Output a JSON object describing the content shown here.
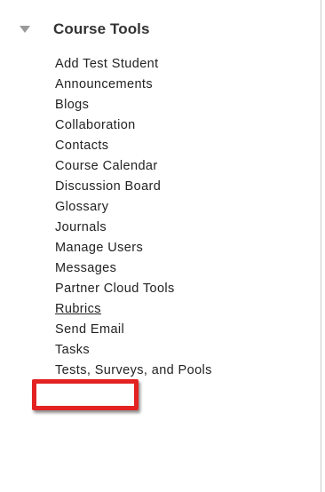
{
  "section": {
    "title": "Course Tools",
    "expanded": true
  },
  "items": [
    {
      "label": "Add Test Student"
    },
    {
      "label": "Announcements"
    },
    {
      "label": "Blogs"
    },
    {
      "label": "Collaboration"
    },
    {
      "label": "Contacts"
    },
    {
      "label": "Course Calendar"
    },
    {
      "label": "Discussion Board"
    },
    {
      "label": "Glossary"
    },
    {
      "label": "Journals"
    },
    {
      "label": "Manage Users"
    },
    {
      "label": "Messages"
    },
    {
      "label": "Partner Cloud Tools"
    },
    {
      "label": "Rubrics",
      "active": true
    },
    {
      "label": "Send Email"
    },
    {
      "label": "Tasks"
    },
    {
      "label": "Tests, Surveys, and Pools"
    }
  ],
  "highlight": {
    "target": "Rubrics",
    "color": "#e32222"
  }
}
